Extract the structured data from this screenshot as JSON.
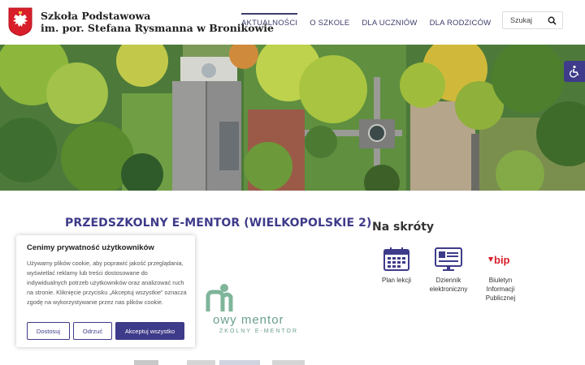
{
  "header": {
    "school_line1": "Szkoła Podstawowa",
    "school_line2": "im. por. Stefana Rysmanna w Bronikowie",
    "nav": [
      {
        "label": "AKTUALNOŚCI",
        "active": true
      },
      {
        "label": "O SZKOLE",
        "active": false
      },
      {
        "label": "DLA UCZNIÓW",
        "active": false
      },
      {
        "label": "DLA RODZICÓW",
        "active": false
      }
    ],
    "search_label": "Szukaj"
  },
  "colors": {
    "accent": "#3e3b8a",
    "crest_red": "#d81e2a",
    "mentor_green": "#6aa08a"
  },
  "article": {
    "title": "PRZEDSZKOLNY E-MENTOR (WIELKOPOLSKIE 2)",
    "logo_main": "owy mentor",
    "logo_sub": "ZKOLNY E-MENTOR"
  },
  "sidebar": {
    "title": "Na skróty",
    "items": [
      {
        "label": "Plan lekcji",
        "icon": "calendar-icon"
      },
      {
        "label": "Dziennik elektroniczny",
        "icon": "monitor-icon"
      },
      {
        "label": "Biuletyn Informacji Publicznej",
        "icon": "bip-icon"
      }
    ],
    "bip_text": "bip"
  },
  "cookie": {
    "title": "Cenimy prywatność użytkowników",
    "text": "Używamy plików cookie, aby poprawić jakość przeglądania, wyświetlać reklamy lub treści dostosowane do indywidualnych potrzeb użytkowników oraz analizować ruch na stronie. Kliknięcie przycisku „Akceptuj wszystkie” oznacza zgodę na wykorzystywanie przez nas plików cookie.",
    "buttons": {
      "customize": "Dostosuj",
      "reject": "Odrzuć",
      "accept": "Akceptuj wszystko"
    }
  }
}
